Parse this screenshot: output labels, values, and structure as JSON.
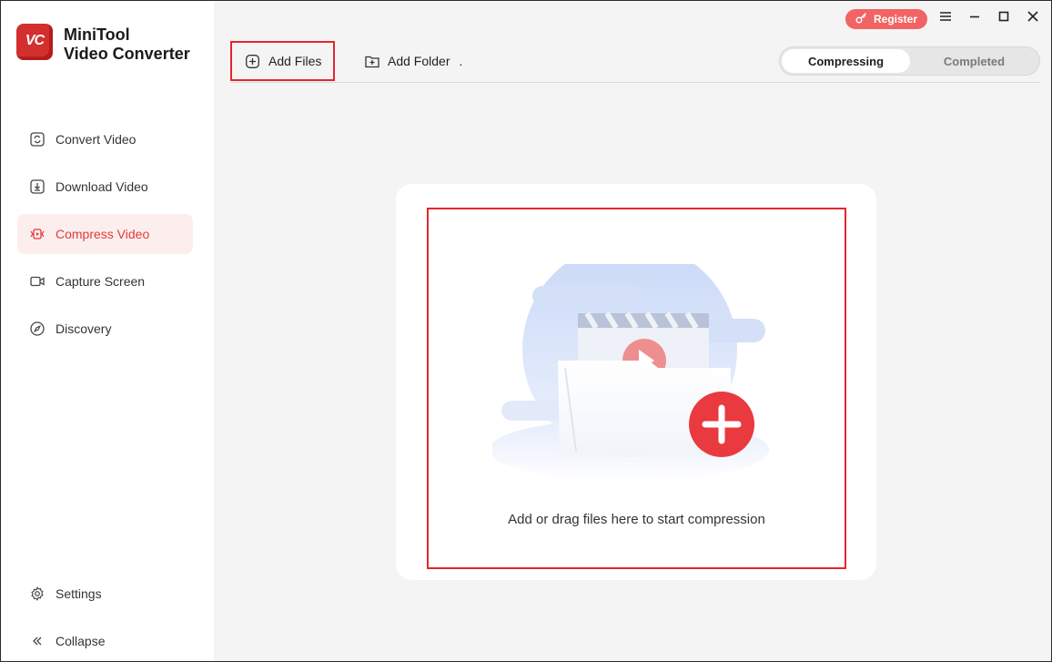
{
  "app": {
    "logo_text": "VC",
    "title_line1": "MiniTool",
    "title_line2": "Video Converter"
  },
  "sidebar": {
    "items": [
      {
        "label": "Convert Video",
        "icon": "convert-icon",
        "active": false
      },
      {
        "label": "Download Video",
        "icon": "download-icon",
        "active": false
      },
      {
        "label": "Compress Video",
        "icon": "compress-icon",
        "active": true
      },
      {
        "label": "Capture Screen",
        "icon": "camera-icon",
        "active": false
      },
      {
        "label": "Discovery",
        "icon": "compass-icon",
        "active": false
      }
    ],
    "bottom": [
      {
        "label": "Settings",
        "icon": "gear-icon"
      },
      {
        "label": "Collapse",
        "icon": "double-chevron-left-icon"
      }
    ]
  },
  "titlebar": {
    "register_label": "Register"
  },
  "toolbar": {
    "add_files_label": "Add Files",
    "add_folder_label": "Add Folder",
    "add_folder_suffix": "."
  },
  "tabs": {
    "items": [
      {
        "label": "Compressing",
        "active": true
      },
      {
        "label": "Completed",
        "active": false
      }
    ]
  },
  "dropzone": {
    "text": "Add or drag files here to start compression"
  },
  "colors": {
    "accent": "#e3262e",
    "register": "#f26363",
    "active_nav_bg": "#fdeeee",
    "main_bg": "#f4f4f4"
  }
}
